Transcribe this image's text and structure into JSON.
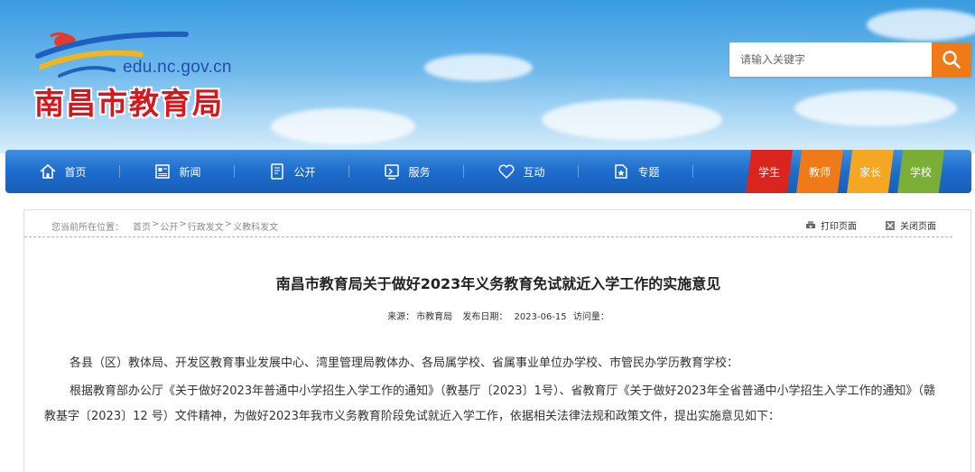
{
  "site": {
    "domain": "edu.nc.gov.cn",
    "title": "南昌市教育局"
  },
  "search": {
    "placeholder": "请输入关键字",
    "button_icon": "search-icon"
  },
  "nav": {
    "items": [
      {
        "label": "首页",
        "icon": "home-icon"
      },
      {
        "label": "新闻",
        "icon": "newspaper-icon"
      },
      {
        "label": "公开",
        "icon": "document-icon"
      },
      {
        "label": "服务",
        "icon": "service-icon"
      },
      {
        "label": "互动",
        "icon": "heart-icon"
      },
      {
        "label": "专题",
        "icon": "topic-icon"
      }
    ],
    "roles": [
      {
        "label": "学生",
        "color": "#d9251d"
      },
      {
        "label": "教师",
        "color": "#f07a18"
      },
      {
        "label": "家长",
        "color": "#f5a623"
      },
      {
        "label": "学校",
        "color": "#7bae37"
      }
    ]
  },
  "breadcrumb": {
    "prefix": "您当前所在位置：",
    "items": [
      "首页",
      "公开",
      "行政发文",
      "义教科发文"
    ],
    "separator": ">"
  },
  "tools": {
    "print": "打印页面",
    "close": "关闭页面"
  },
  "article": {
    "title": "南昌市教育局关于做好2023年义务教育免试就近入学工作的实施意见",
    "meta": {
      "source_label": "来源：",
      "source": "市教育局",
      "date_label": "发布日期：",
      "date": "2023-06-15",
      "views_label": "访问量："
    },
    "paragraphs": [
      "各县（区）教体局、开发区教育事业发展中心、湾里管理局教体办、各局属学校、省属事业单位办学校、市管民办学历教育学校：",
      "根据教育部办公厅《关于做好2023年普通中小学招生入学工作的通知》（教基厅〔2023〕1号）、省教育厅《关于做好2023年全省普通中小学招生入学工作的通知》（赣教基字〔2023〕12 号）文件精神，为做好2023年我市义务教育阶段免试就近入学工作，依据相关法律法规和政策文件，提出实施意见如下："
    ]
  }
}
